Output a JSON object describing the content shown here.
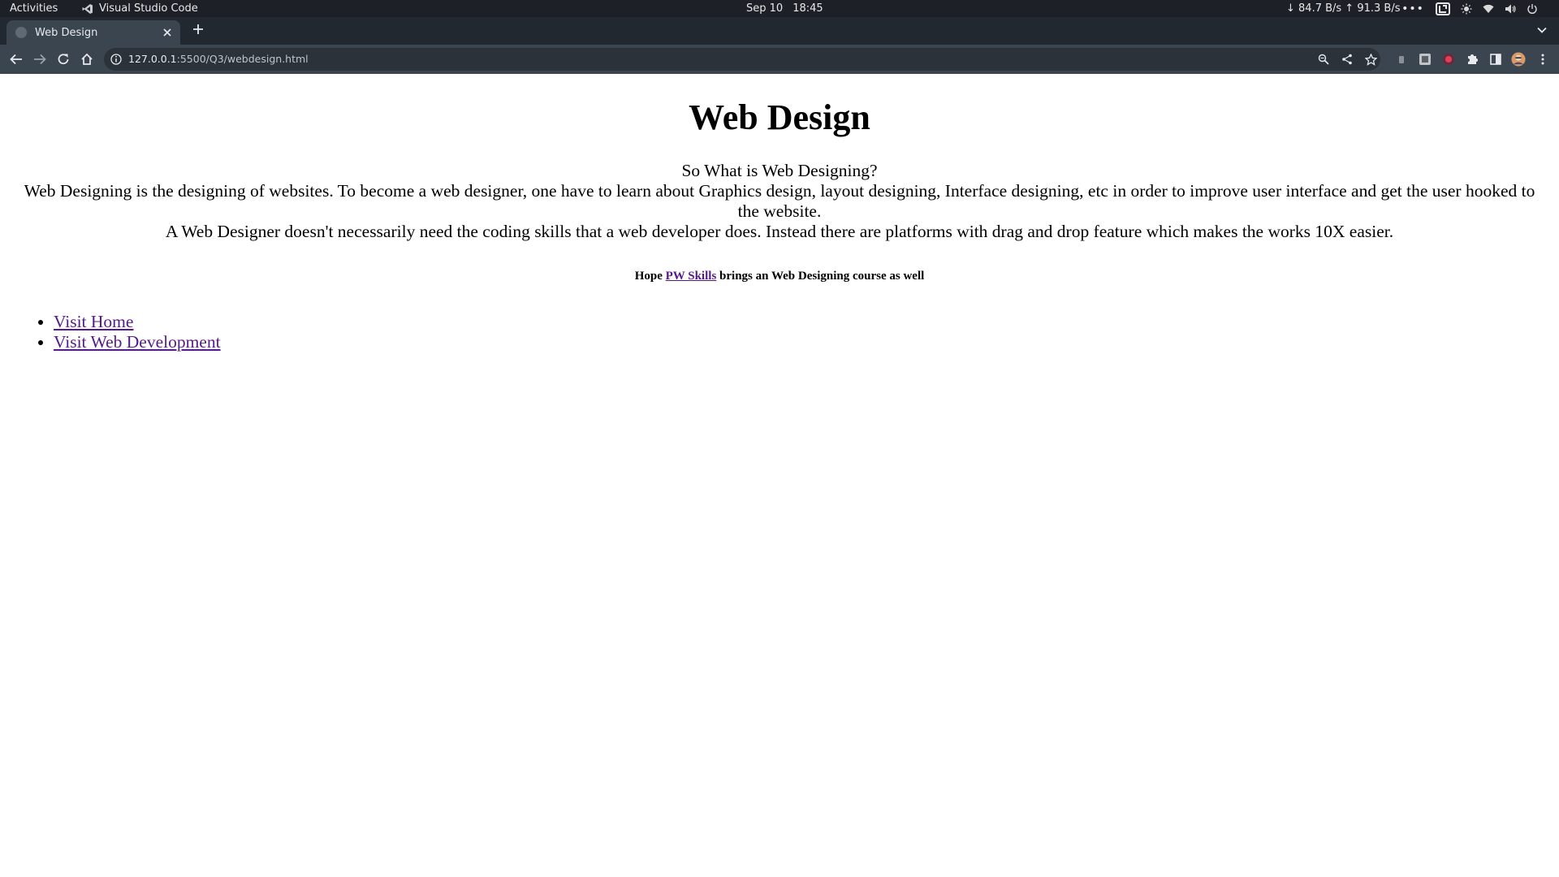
{
  "topbar": {
    "activities": "Activities",
    "app_name": "Visual Studio Code",
    "date": "Sep 10",
    "time": "18:45",
    "net_speed": "↓ 84.7 B/s ↑ 91.3 B/s",
    "overflow": "•••"
  },
  "browser": {
    "tab_title": "Web Design",
    "url_host": "127.0.0.1",
    "url_rest": ":5500/Q3/webdesign.html"
  },
  "page": {
    "heading": "Web Design",
    "question": "So What is Web Designing?",
    "paragraph1": "Web Designing is the designing of websites. To become a web designer, one have to learn about Graphics design, layout designing, Interface designing, etc in order to improve user interface and get the user hooked to the website.",
    "paragraph2": "A Web Designer doesn't necessarily need the coding skills that a web developer does. Instead there are platforms with drag and drop feature which makes the works 10X easier.",
    "hope_before": "Hope ",
    "hope_link": "PW Skills",
    "hope_after": " brings an Web Designing course as well",
    "links": [
      "Visit Home",
      "Visit Web Development"
    ]
  },
  "colors": {
    "visited_link": "#551a8b",
    "toolbar_bg": "#3b4550",
    "topbar_bg": "#1d2127"
  },
  "icons": [
    "vscode-icon",
    "lenovo-icon",
    "brightness-icon",
    "wifi-icon",
    "volume-icon",
    "power-icon",
    "close-icon",
    "plus-icon",
    "chevron-down-icon",
    "back-icon",
    "forward-icon",
    "reload-icon",
    "home-icon",
    "info-icon",
    "zoom-icon",
    "share-icon",
    "star-icon",
    "extensions-icon",
    "sidepanel-icon",
    "avatar",
    "menu-icon"
  ]
}
